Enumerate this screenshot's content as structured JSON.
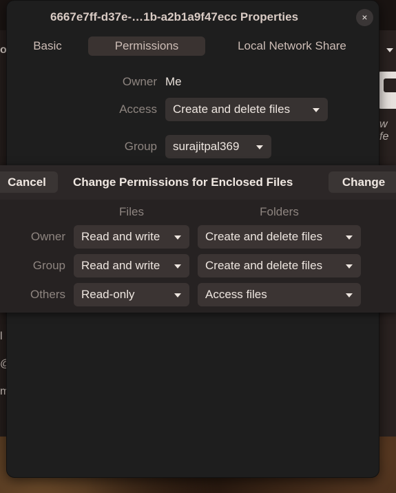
{
  "window": {
    "title": "6667e7ff-d37e-…1b-a2b1a9f47ecc Properties",
    "close_icon": "×"
  },
  "tabs": [
    {
      "label": "Basic"
    },
    {
      "label": "Permissions"
    },
    {
      "label": "Local Network Share"
    }
  ],
  "permissions": {
    "owner_label": "Owner",
    "owner_value": "Me",
    "access_label": "Access",
    "access_value": "Create and delete files",
    "group_label": "Group",
    "group_value": "surajitpal369"
  },
  "background": {
    "text_w": "w fe",
    "text_l": "l",
    "text_at": "@",
    "text_m": "m",
    "text_o": "o"
  },
  "enclosed": {
    "cancel_label": "Cancel",
    "title": "Change Permissions for Enclosed Files",
    "change_label": "Change",
    "files_header": "Files",
    "folders_header": "Folders",
    "rows": [
      {
        "label": "Owner",
        "files": "Read and write",
        "folders": "Create and delete files"
      },
      {
        "label": "Group",
        "files": "Read and write",
        "folders": "Create and delete files"
      },
      {
        "label": "Others",
        "files": "Read-only",
        "folders": "Access files"
      }
    ]
  }
}
